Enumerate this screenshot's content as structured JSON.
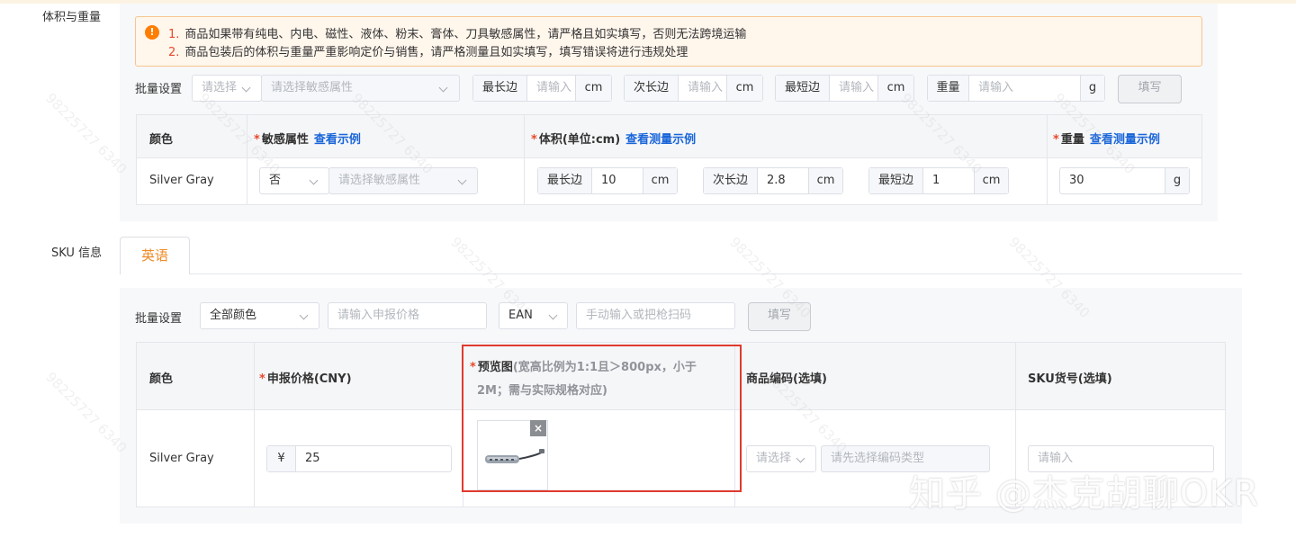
{
  "volume_section": {
    "label": "体积与重量",
    "alert": {
      "line1_num": "1.",
      "line1": "商品如果带有纯电、内电、磁性、液体、粉末、膏体、刀具敏感属性，请严格且如实填写，否则无法跨境运输",
      "line2_num": "2.",
      "line2": "商品包装后的体积与重量严重影响定价与销售，请严格测量且如实填写，填写错误将进行违规处理"
    },
    "batch": {
      "label": "批量设置",
      "select_placeholder": "请选择",
      "sensitive_placeholder": "请选择敏感属性",
      "longest_label": "最长边",
      "second_label": "次长边",
      "shortest_label": "最短边",
      "weight_label": "重量",
      "input_placeholder": "请输入",
      "unit_cm": "cm",
      "unit_g": "g",
      "fill_button": "填写"
    },
    "table": {
      "headers": {
        "color": "颜色",
        "sensitive": "敏感属性",
        "sensitive_link": "查看示例",
        "volume": "体积(单位:cm)",
        "volume_link": "查看测量示例",
        "weight": "重量",
        "weight_link": "查看测量示例"
      },
      "row": {
        "color": "Silver Gray",
        "sensitive_value": "否",
        "sensitive_placeholder": "请选择敏感属性",
        "longest_label": "最长边",
        "longest_value": "10",
        "second_label": "次长边",
        "second_value": "2.8",
        "shortest_label": "最短边",
        "shortest_value": "1",
        "unit_cm": "cm",
        "weight_value": "30",
        "unit_g": "g"
      }
    }
  },
  "sku_section": {
    "label": "SKU 信息",
    "tab_label": "英语",
    "batch": {
      "label": "批量设置",
      "color_select": "全部颜色",
      "price_placeholder": "请输入申报价格",
      "code_type": "EAN",
      "code_placeholder": "手动输入或把枪扫码",
      "fill_button": "填写"
    },
    "table": {
      "headers": {
        "color": "颜色",
        "price": "申报价格(CNY)",
        "preview": "预览图",
        "preview_hint_line1": "(宽高比例为1:1且＞800px，小于",
        "preview_hint_line2": "2M；需与实际规格对应)",
        "code": "商品编码(选填)",
        "sku": "SKU货号(选填)"
      },
      "row": {
        "color": "Silver Gray",
        "currency": "¥",
        "price": "25",
        "code_select_placeholder": "请选择",
        "code_input_placeholder": "请先选择编码类型",
        "sku_placeholder": "请输入"
      }
    }
  },
  "watermark": {
    "id_text": "98225727 6340",
    "brand": "知乎 @杰克胡聊OKR"
  },
  "icons": {
    "alert": "warning-circle-icon",
    "chevron": "chevron-down-icon",
    "close": "close-icon",
    "product": "usb-hub-product-image"
  },
  "colors": {
    "accent_orange": "#f08a24",
    "required_red": "#e8492b",
    "link_blue": "#1a66d9",
    "highlight_red": "#e03a2f"
  }
}
